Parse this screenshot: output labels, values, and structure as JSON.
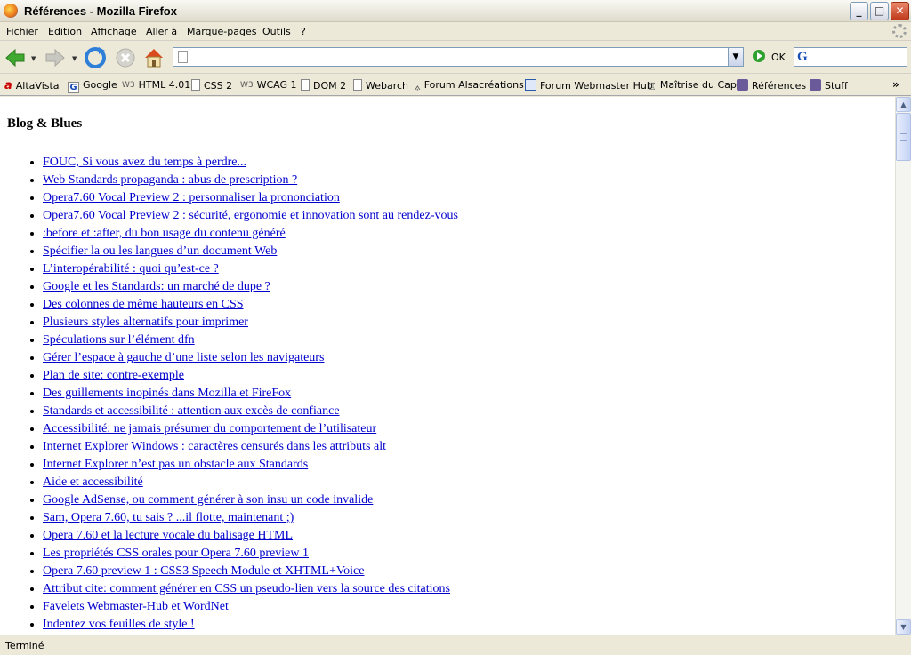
{
  "window": {
    "title": "Références - Mozilla Firefox",
    "minimize": "_",
    "maximize": "□",
    "close": "✕"
  },
  "menu": [
    "Fichier",
    "Edition",
    "Affichage",
    "Aller à",
    "Marque-pages",
    "Outils",
    "?"
  ],
  "nav": {
    "go_label": "OK",
    "url_value": "",
    "search_value": ""
  },
  "bookmarks": [
    {
      "label": "AltaVista",
      "icon": "altavista-icon"
    },
    {
      "label": "Google",
      "icon": "google-icon"
    },
    {
      "label": "HTML 4.01",
      "icon": "w3c-icon"
    },
    {
      "label": "CSS 2",
      "icon": "page-icon"
    },
    {
      "label": "WCAG 1",
      "icon": "w3c-icon"
    },
    {
      "label": "DOM 2",
      "icon": "page-icon"
    },
    {
      "label": "Webarch",
      "icon": "page-icon"
    },
    {
      "label": "Forum Alsacréations",
      "icon": "alsacreations-icon"
    },
    {
      "label": "Forum Webmaster Hub",
      "icon": "webmasterhub-icon"
    },
    {
      "label": "Maîtrise du Cap",
      "icon": "cap-icon"
    },
    {
      "label": "Références",
      "icon": "folder-icon"
    },
    {
      "label": "Stuff",
      "icon": "folder-icon"
    }
  ],
  "bookmarks_more": "»",
  "page": {
    "heading": "Blog & Blues",
    "links": [
      "FOUC, Si vous avez du temps à perdre...",
      "Web Standards propaganda : abus de prescription ?",
      "Opera7.60 Vocal Preview 2 : personnaliser la prononciation",
      "Opera7.60 Vocal Preview 2 : sécurité, ergonomie et innovation sont au rendez-vous",
      ":before et :after, du bon usage du contenu généré",
      "Spécifier la ou les langues d’un document Web",
      "L’interopérabilité : quoi qu’est-ce ?",
      "Google et les Standards: un marché de dupe ?",
      "Des colonnes de même hauteurs en CSS",
      "Plusieurs styles alternatifs pour imprimer",
      "Spéculations sur l’élément dfn",
      "Gérer l’espace à gauche d’une liste selon les navigateurs",
      "Plan de site: contre-exemple",
      "Des guillements inopinés dans Mozilla et FireFox",
      "Standards et accessibilité : attention aux excès de confiance",
      "Accessibilité: ne jamais présumer du comportement de l’utilisateur",
      "Internet Explorer Windows : caractères censurés dans les attributs alt",
      "Internet Explorer n’est pas un obstacle aux Standards",
      "Aide et accessibilité",
      "Google AdSense, ou comment générer à son insu un code invalide",
      "Sam, Opera 7.60, tu sais ? ...il flotte, maintenant ;)",
      "Opera 7.60 et la lecture vocale du balisage HTML",
      "Les propriétés CSS orales pour Opera 7.60 preview 1",
      "Opera 7.60 preview 1 : CSS3 Speech Module et XHTML+Voice",
      "Attribut cite: comment générer en CSS un pseudo-lien vers la source des citations",
      "Favelets Webmaster-Hub et WordNet",
      "Indentez vos feuilles de style !"
    ]
  },
  "status": "Terminé"
}
